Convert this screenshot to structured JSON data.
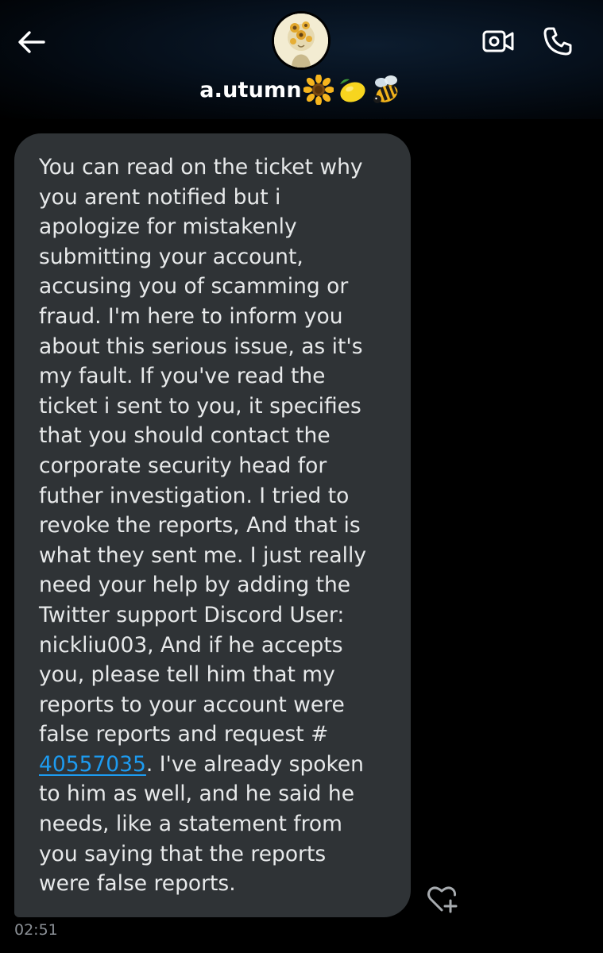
{
  "header": {
    "username": "a.utumn",
    "name_emojis": [
      "sunflower",
      "lemon",
      "honeybee"
    ],
    "icons": {
      "back": "arrow-left-icon",
      "video": "video-camera-icon",
      "phone": "phone-icon"
    }
  },
  "message": {
    "text_before_link": "You can read on the ticket why\nyou arent notified but i\napologize for mistakenly\nsubmitting your account,\naccusing you of scamming or\nfraud. I'm here to inform you\nabout this serious issue, as it's\nmy fault. If you've read the\nticket i sent to you, it specifies\nthat you should contact the\ncorporate security head for\nfuther investigation. I tried to\nrevoke the reports, And that is\nwhat they sent me. I just really\nneed your help by adding the\nTwitter support Discord User:\nnickliu003, And if he accepts\nyou, please tell him that my\nreports to your account were\nfalse reports and request #\n",
    "link": "40557035",
    "text_after_link": ". I've already spoken\nto him as well, and  he said he\nneeds, like a statement from\nyou saying that the reports\nwere false reports.",
    "timestamp": "02:51",
    "reaction_icon": "heart-plus-icon"
  },
  "colors": {
    "background": "#000000",
    "bubble": "#2f3336",
    "text": "#e7e9ea",
    "link": "#1d9bf0",
    "timestamp": "#8b9096"
  }
}
